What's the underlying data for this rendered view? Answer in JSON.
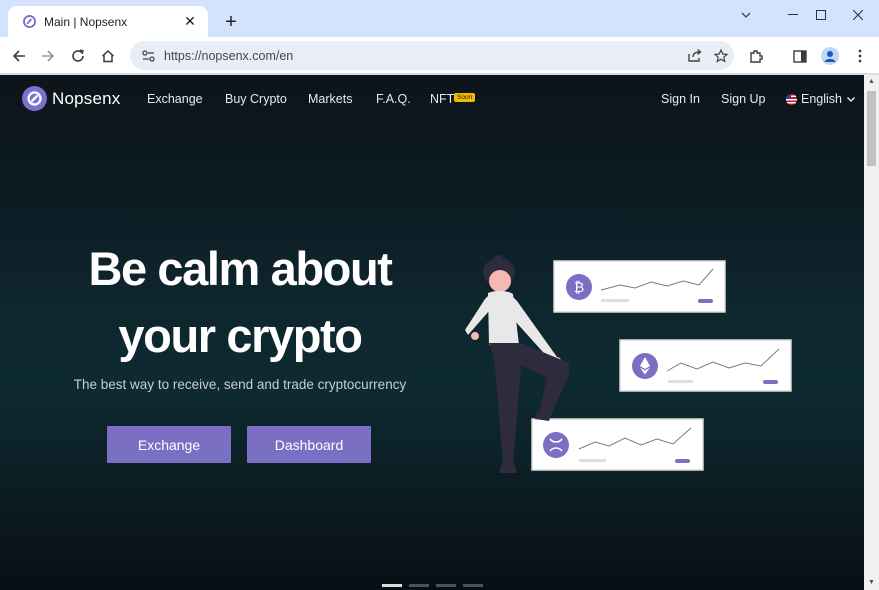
{
  "browser": {
    "tab_title": "Main | Nopsenx",
    "url": "https://nopsenx.com/en",
    "new_tab_label": "+",
    "window_controls": [
      "minimize-icon",
      "maximize-icon",
      "close-icon"
    ]
  },
  "site": {
    "brand": "Nopsenx",
    "nav": {
      "exchange": "Exchange",
      "buy_crypto": "Buy Crypto",
      "markets": "Markets",
      "faq": "F.A.Q.",
      "nft": "NFT",
      "nft_badge": "Soon",
      "sign_in": "Sign In",
      "sign_up": "Sign Up",
      "language": "English"
    },
    "hero": {
      "title_line1": "Be calm about",
      "title_line2": "your crypto",
      "subtitle": "The best way to receive, send and trade cryptocurrency",
      "primary_button": "Exchange",
      "secondary_button": "Dashboard"
    },
    "carousel": {
      "slides": 4,
      "active": 0
    },
    "colors": {
      "accent": "#7b6fc4",
      "badge": "#f2b900",
      "background": "#0e262e"
    },
    "illustration_cards": [
      "bitcoin-icon",
      "ethereum-icon",
      "xrp-icon"
    ]
  }
}
